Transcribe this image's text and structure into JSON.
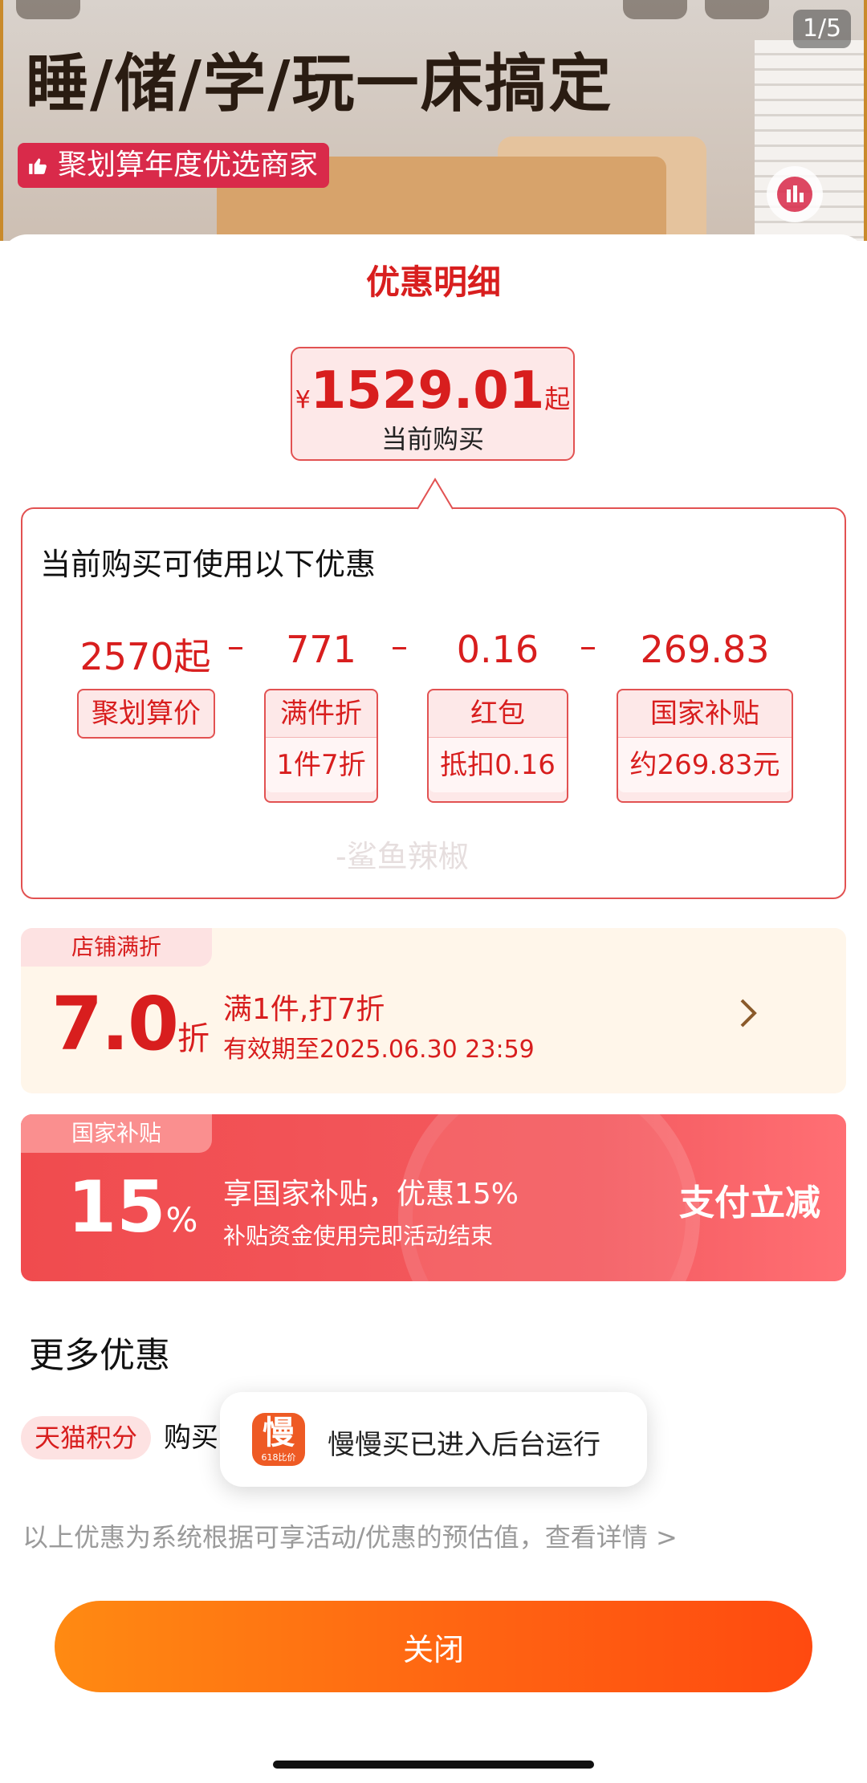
{
  "banner": {
    "page_indicator": "1/5",
    "headline": "睡/储/学/玩一床搞定",
    "seller_tag": "聚划算年度优选商家"
  },
  "sheet": {
    "title": "优惠明细",
    "price": {
      "symbol": "¥",
      "amount": "1529.01",
      "suffix": "起",
      "caption": "当前购买"
    },
    "discounts": {
      "heading": "当前购买可使用以下优惠",
      "minus": "–",
      "items": [
        {
          "value": "2570起",
          "label": "聚划算价",
          "detail": ""
        },
        {
          "value": "771",
          "label": "满件折",
          "detail": "1件7折"
        },
        {
          "value": "0.16",
          "label": "红包",
          "detail": "抵扣0.16"
        },
        {
          "value": "269.83",
          "label": "国家补贴",
          "detail": "约269.83元"
        }
      ],
      "watermark": "-鲨鱼辣椒"
    },
    "store_offer": {
      "tag": "店铺满折",
      "rate": "7.0",
      "unit": "折",
      "line1": "满1件,打7折",
      "line2": "有效期至2025.06.30 23:59"
    },
    "subsidy_offer": {
      "tag": "国家补贴",
      "rate": "15",
      "unit": "%",
      "line1": "享国家补贴，优惠15%",
      "line2": "补贴资金使用完即活动结束",
      "action": "支付立减"
    },
    "more": {
      "title": "更多优惠",
      "badge": "天猫积分",
      "text": "购买"
    },
    "toast": {
      "icon_glyph": "慢",
      "icon_sub": "618比价",
      "text": "慢慢买已进入后台运行"
    },
    "disclaimer": "以上优惠为系统根据可享活动/优惠的预估值，查看详情 >",
    "close_label": "关闭"
  },
  "colors": {
    "accent_red": "#d81e1e",
    "subsidy_red": "#f04b4e",
    "button_orange": "#ff6412"
  }
}
